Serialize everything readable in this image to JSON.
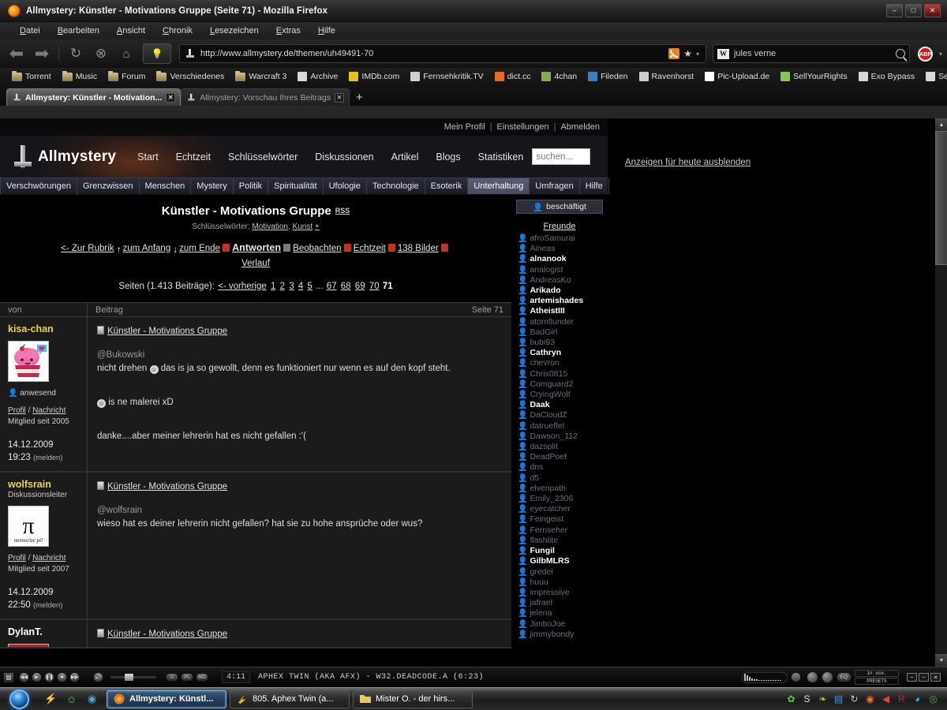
{
  "browser": {
    "window_title": "Allmystery: Künstler - Motivations Gruppe (Seite 71) - Mozilla Firefox",
    "menu": [
      "Datei",
      "Bearbeiten",
      "Ansicht",
      "Chronik",
      "Lesezeichen",
      "Extras",
      "Hilfe"
    ],
    "url": "http://www.allmystery.de/themen/uh49491-70",
    "search_engine": "W",
    "search_value": "jules verne",
    "bookmarks": [
      {
        "label": "Torrent",
        "icon": "folder-icon",
        "color": "#cfc08a"
      },
      {
        "label": "Music",
        "icon": "folder-icon",
        "color": "#cfc08a"
      },
      {
        "label": "Forum",
        "icon": "folder-icon",
        "color": "#cfc08a"
      },
      {
        "label": "Verschiedenes",
        "icon": "folder-icon",
        "color": "#cfc08a"
      },
      {
        "label": "Warcraft 3",
        "icon": "folder-icon",
        "color": "#cfc08a"
      },
      {
        "label": "Archive",
        "icon": "site-icon",
        "color": "#d8d8d8"
      },
      {
        "label": "IMDb.com",
        "icon": "imdb-icon",
        "color": "#e8c11a"
      },
      {
        "label": "Fernsehkritik.TV",
        "icon": "film-icon",
        "color": "#d0d0d0"
      },
      {
        "label": "dict.cc",
        "icon": "dict-icon",
        "color": "#e86a1a"
      },
      {
        "label": "4chan",
        "icon": "fourchan-icon",
        "color": "#88aa55"
      },
      {
        "label": "Fileden",
        "icon": "fileden-icon",
        "color": "#3a7fc4"
      },
      {
        "label": "Ravenhorst",
        "icon": "raven-icon",
        "color": "#cccccc"
      },
      {
        "label": "Pic-Upload.de",
        "icon": "picupload-icon",
        "color": "#ffffff"
      },
      {
        "label": "SellYourRights",
        "icon": "leaf-icon",
        "color": "#88c455"
      },
      {
        "label": "Exo Bypass",
        "icon": "page-icon",
        "color": "#d8d8d8"
      },
      {
        "label": "Serials & Keys",
        "icon": "page-icon",
        "color": "#d8d8d8"
      }
    ],
    "bookmarks_overflow": "»",
    "tabs": [
      {
        "label": "Allmystery: Künstler - Motivation...",
        "active": true
      },
      {
        "label": "Allmystery: Vorschau Ihres Beitrags",
        "active": false
      }
    ],
    "new_tab_label": "+",
    "window_buttons": {
      "minimize": "–",
      "maximize": "□",
      "close": "✕"
    }
  },
  "site": {
    "account_links": [
      "Mein Profil",
      "Einstellungen",
      "Abmelden"
    ],
    "brand": "Allmystery",
    "main_nav": [
      "Start",
      "Echtzeit",
      "Schlüsselwörter",
      "Diskussionen",
      "Artikel",
      "Blogs",
      "Statistiken"
    ],
    "search_placeholder": "suchen...",
    "categories": [
      {
        "label": "Verschwörungen",
        "active": false
      },
      {
        "label": "Grenzwissen",
        "active": false
      },
      {
        "label": "Menschen",
        "active": false
      },
      {
        "label": "Mystery",
        "active": false
      },
      {
        "label": "Politik",
        "active": false
      },
      {
        "label": "Spiritualität",
        "active": false
      },
      {
        "label": "Ufologie",
        "active": false
      },
      {
        "label": "Technologie",
        "active": false
      },
      {
        "label": "Esoterik",
        "active": false
      },
      {
        "label": "Unterhaltung",
        "active": true
      },
      {
        "label": "Umfragen",
        "active": false
      },
      {
        "label": "Hilfe",
        "active": false
      }
    ],
    "ad_hide_link": "Anzeigen für heute ausblenden"
  },
  "thread": {
    "title": "Künstler - Motivations Gruppe",
    "rss_label": "RSS",
    "keywords_label": "Schlüsselwörter:",
    "keywords": [
      "Motivation",
      "Kunst"
    ],
    "keywords_add": "+",
    "tools": [
      {
        "label": "<- Zur Rubrik",
        "icon": "back-arrow-icon",
        "strong": false
      },
      {
        "label": "zum Anfang",
        "icon": "arrow-up-icon",
        "strong": false
      },
      {
        "label": "zum Ende",
        "icon": "arrow-down-icon",
        "strong": false
      },
      {
        "label": "Antworten",
        "icon": "reply-icon",
        "strong": true
      },
      {
        "label": "Beobachten",
        "icon": "watch-icon",
        "strong": false
      },
      {
        "label": "Echtzeit",
        "icon": "realtime-icon",
        "strong": false
      },
      {
        "label": "138 Bilder",
        "icon": "images-icon",
        "strong": false
      },
      {
        "label": "Verlauf",
        "icon": "history-icon",
        "strong": false
      }
    ],
    "pager_label": "Seiten (1.413 Beiträge):",
    "pager_prev": "<- vorherige",
    "pager_pages": [
      "1",
      "2",
      "3",
      "4",
      "5",
      "...",
      "67",
      "68",
      "69",
      "70"
    ],
    "pager_current": "71",
    "table_headers": {
      "von": "von",
      "beitrag": "Beitrag",
      "seite": "Seite 71"
    },
    "posts": [
      {
        "user": "kisa-chan",
        "user_color": "#e8d44a",
        "role": "",
        "avatar": "cupcake-avatar",
        "status": "anwesend",
        "profil": "Profil",
        "nachricht": "Nachricht",
        "member_since": "Mitglied seit 2005",
        "date": "14.12.2009",
        "time": "19:23",
        "melden": "(melden)",
        "title": "Künstler - Motivations Gruppe",
        "mention": "@Bukowski",
        "lines": [
          "nicht drehen ☺ das is ja so gewollt, denn es funktioniert nur wenn es auf den kopf steht.",
          "☺ is ne malerei xD",
          "danke....aber meiner lehrerin hat es nicht gefallen :'("
        ]
      },
      {
        "user": "wolfsrain",
        "user_color": "#e8d44a",
        "role": "Diskussionsleiter",
        "avatar": "pi-avatar",
        "status": "",
        "profil": "Profil",
        "nachricht": "Nachricht",
        "member_since": "Mitglied seit 2007",
        "date": "14.12.2009",
        "time": "22:50",
        "melden": "(melden)",
        "title": "Künstler - Motivations Gruppe",
        "mention": "@wolfsrain",
        "lines": [
          "wieso hat es deiner lehrerin nicht gefallen? hat sie zu hohe ansprüche oder wus?"
        ]
      },
      {
        "user": "DylanT.",
        "user_color": "#ffffff",
        "role": "",
        "avatar": "red-avatar",
        "status": "",
        "profil": "",
        "nachricht": "",
        "member_since": "",
        "date": "",
        "time": "",
        "melden": "",
        "title": "Künstler - Motivations Gruppe",
        "mention": "",
        "lines": []
      }
    ]
  },
  "sidebar": {
    "status_label": "beschäftigt",
    "friends_title": "Freunde",
    "friends": [
      {
        "name": "afroSamurai",
        "state": "off"
      },
      {
        "name": "Aineas",
        "state": "off"
      },
      {
        "name": "alnanook",
        "state": "busy"
      },
      {
        "name": "analogist",
        "state": "off"
      },
      {
        "name": "AndreasKo",
        "state": "off"
      },
      {
        "name": "Arikado",
        "state": "on"
      },
      {
        "name": "artemishades",
        "state": "busy"
      },
      {
        "name": "AtheistIII",
        "state": "on"
      },
      {
        "name": "atomflunder",
        "state": "off"
      },
      {
        "name": "BadGirl",
        "state": "off"
      },
      {
        "name": "bubi93",
        "state": "off"
      },
      {
        "name": "Cathryn",
        "state": "busy"
      },
      {
        "name": "chevron",
        "state": "off"
      },
      {
        "name": "Chris0815",
        "state": "off"
      },
      {
        "name": "Comguard2",
        "state": "off"
      },
      {
        "name": "CryingWolf",
        "state": "off"
      },
      {
        "name": "Daak",
        "state": "on"
      },
      {
        "name": "DaCloudZ",
        "state": "off"
      },
      {
        "name": "datrueffel",
        "state": "off"
      },
      {
        "name": "Dawson_112",
        "state": "off"
      },
      {
        "name": "dazsplit",
        "state": "off"
      },
      {
        "name": "DeadPoet",
        "state": "off"
      },
      {
        "name": "dns",
        "state": "off"
      },
      {
        "name": "d5",
        "state": "off"
      },
      {
        "name": "elvenpath",
        "state": "off"
      },
      {
        "name": "Emily_2306",
        "state": "off"
      },
      {
        "name": "eyecatcher",
        "state": "off"
      },
      {
        "name": "Feingeist",
        "state": "off"
      },
      {
        "name": "Fernseher",
        "state": "off"
      },
      {
        "name": "flashlite",
        "state": "off"
      },
      {
        "name": "Fungil",
        "state": "on"
      },
      {
        "name": "GilbMLRS",
        "state": "on"
      },
      {
        "name": "gredel",
        "state": "off"
      },
      {
        "name": "huuu",
        "state": "off"
      },
      {
        "name": "impressive",
        "state": "off"
      },
      {
        "name": "jafrael",
        "state": "off"
      },
      {
        "name": "jelena",
        "state": "off"
      },
      {
        "name": "JimboJoe",
        "state": "off"
      },
      {
        "name": "jimmybondy",
        "state": "off"
      }
    ]
  },
  "winamp": {
    "time": "4:11",
    "track": "APHEX TWIN (AKA AFX) - W32.DEADCODE.A (6:23)",
    "buttons": [
      "◀◀",
      "▶",
      "❚❚",
      "■",
      "▶▶"
    ],
    "toggles": [
      "O",
      "PL",
      "MD"
    ],
    "eq_label": "EQ",
    "lcd_top": "in use.",
    "lcd_bottom": "PRESETS"
  },
  "taskbar": {
    "quicklaunch": [
      "winamp-icon",
      "media-icon",
      "browser-icon"
    ],
    "tasks": [
      {
        "label": "Allmystery: Künstl...",
        "icon": "firefox-icon",
        "active": true
      },
      {
        "label": "805. Aphex Twin (a...",
        "icon": "winamp-icon",
        "active": false
      },
      {
        "label": "Mister O. - der hirs...",
        "icon": "folder-icon",
        "active": false
      }
    ],
    "tray": [
      "clover-icon",
      "sr-icon",
      "leaf-icon",
      "window-icon",
      "sync-icon",
      "firefox-icon",
      "speaker-icon",
      "avira-icon",
      "drop-icon",
      "eye-icon"
    ]
  }
}
